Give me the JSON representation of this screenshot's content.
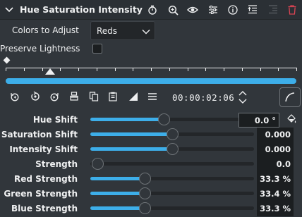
{
  "header": {
    "title": "Hue Saturation Intensity",
    "icons": [
      "chevron-down-icon",
      "timer-icon",
      "zoom-icon",
      "eye-icon",
      "sliders-icon",
      "info-icon",
      "insert-icon",
      "remove-icon",
      "delete-icon"
    ]
  },
  "colors_to_adjust": {
    "label": "Colors to Adjust",
    "value": "Reds"
  },
  "preserve_lightness": {
    "label": "Preserve Lightness",
    "checked": false
  },
  "timeline": {
    "timecode": "00:00:02:06"
  },
  "params": [
    {
      "label": "Hue Shift",
      "value": "0.0 °",
      "level": 0.45
    },
    {
      "label": "Saturation Shift",
      "value": "0.000",
      "level": 0.5
    },
    {
      "label": "Intensity Shift",
      "value": "0.000",
      "level": 0.5
    },
    {
      "label": "Strength",
      "value": "0.0",
      "level": 0.0
    },
    {
      "label": "Red Strength",
      "value": "33.3 %",
      "level": 0.333
    },
    {
      "label": "Green Strength",
      "value": "33.4 %",
      "level": 0.334
    },
    {
      "label": "Blue Strength",
      "value": "33.3 %",
      "level": 0.333
    }
  ],
  "colors": {
    "accent": "#3daee9",
    "background": "#31363b",
    "delete": "#da4453"
  }
}
